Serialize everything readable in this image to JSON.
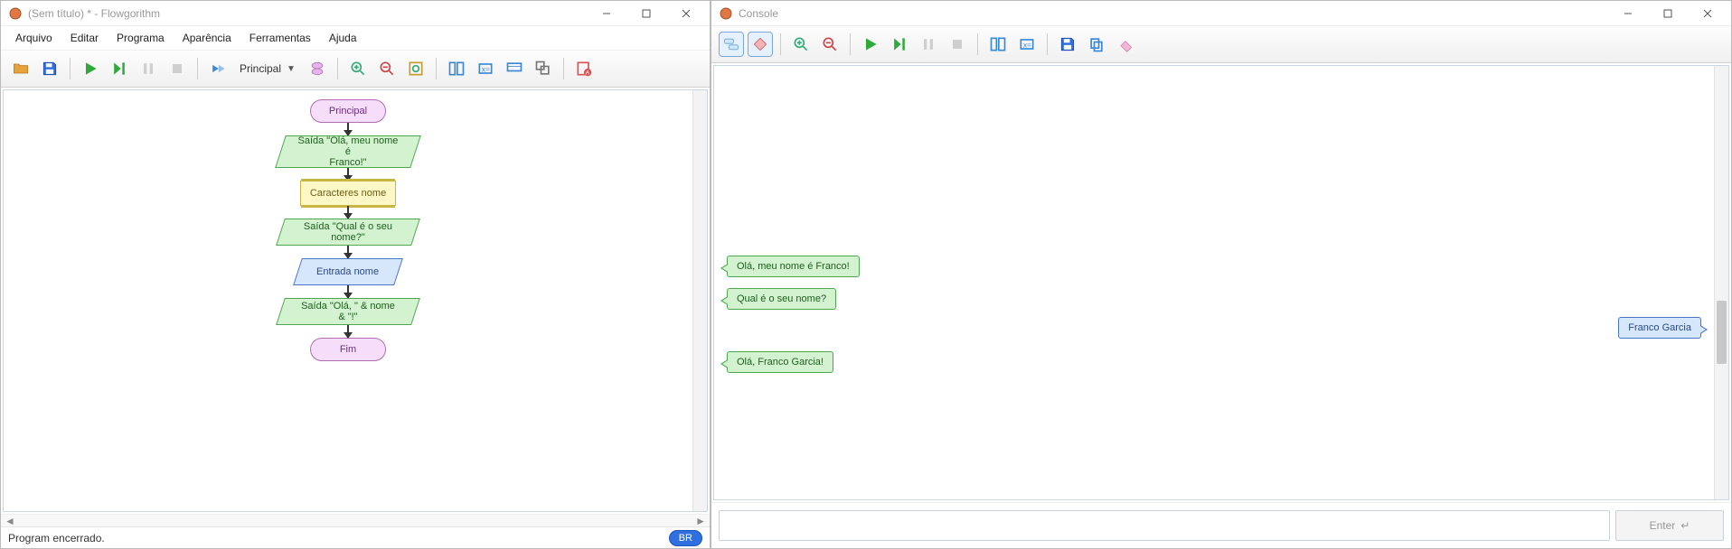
{
  "left": {
    "title": "(Sem título) * - Flowgorithm",
    "menu": [
      "Arquivo",
      "Editar",
      "Programa",
      "Aparência",
      "Ferramentas",
      "Ajuda"
    ],
    "dropdown": "Principal",
    "status": "Program encerrado.",
    "locale_badge": "BR",
    "flow": {
      "start": "Principal",
      "out1_l1": "Saída \"Olá, meu nome é",
      "out1_l2": "Franco!\"",
      "decl": "Caracteres nome",
      "out2": "Saída \"Qual é o seu nome?\"",
      "inp": "Entrada nome",
      "out3": "Saída \"Olá, \" & nome & \"!\"",
      "end": "Fim"
    }
  },
  "right": {
    "title": "Console",
    "messages": {
      "m1": "Olá, meu nome é Franco!",
      "m2": "Qual é o seu nome?",
      "m3": "Franco Garcia",
      "m4": "Olá, Franco Garcia!"
    },
    "enter": "Enter"
  }
}
